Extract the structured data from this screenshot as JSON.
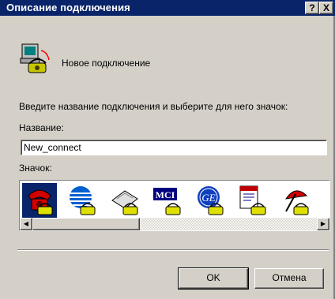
{
  "window": {
    "title": "Описание подключения",
    "help_btn": "?",
    "close_btn": "X"
  },
  "connection": {
    "name": "Новое подключение"
  },
  "instructions": "Введите название подключения и выберите для него значок:",
  "name_label": "Название:",
  "name_value": "New_connect",
  "icon_label": "Значок:",
  "icons": [
    {
      "name": "red-phone-icon",
      "selected": true
    },
    {
      "name": "globe-phone-icon",
      "selected": false
    },
    {
      "name": "fax-phone-icon",
      "selected": false
    },
    {
      "name": "mci-phone-icon",
      "selected": false
    },
    {
      "name": "ge-phone-icon",
      "selected": false
    },
    {
      "name": "notepad-phone-icon",
      "selected": false
    },
    {
      "name": "umbrella-phone-icon",
      "selected": false
    }
  ],
  "buttons": {
    "ok": "OK",
    "cancel": "Отмена"
  },
  "colors": {
    "titlebar": "#0a246a",
    "face": "#d4d0c8"
  }
}
